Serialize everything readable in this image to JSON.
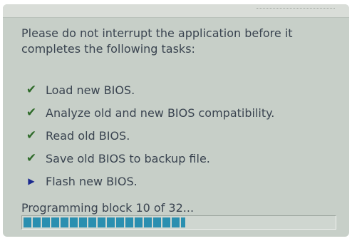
{
  "dialog": {
    "intro": "Please do not interrupt the application before it\ncompletes the following tasks:",
    "tasks": [
      {
        "label": "Load new BIOS.",
        "icon": "check-icon",
        "done": true
      },
      {
        "label": "Analyze old and new BIOS compatibility.",
        "icon": "check-icon",
        "done": true
      },
      {
        "label": "Read old BIOS.",
        "icon": "check-icon",
        "done": true
      },
      {
        "label": "Save old BIOS to backup file.",
        "icon": "check-icon",
        "done": true
      },
      {
        "label": "Flash new BIOS.",
        "icon": "arrow-icon",
        "done": false
      }
    ],
    "status": "Programming block 10 of 32...",
    "progress": {
      "current_block": 10,
      "total_blocks": 32,
      "fill_fraction": 0.52
    }
  },
  "colors": {
    "panel_background": "#c7cfc8",
    "text": "#3a4450",
    "check": "#2f6b2a",
    "arrow": "#1b2a8f",
    "progress_fill": "#2a8fb0"
  }
}
